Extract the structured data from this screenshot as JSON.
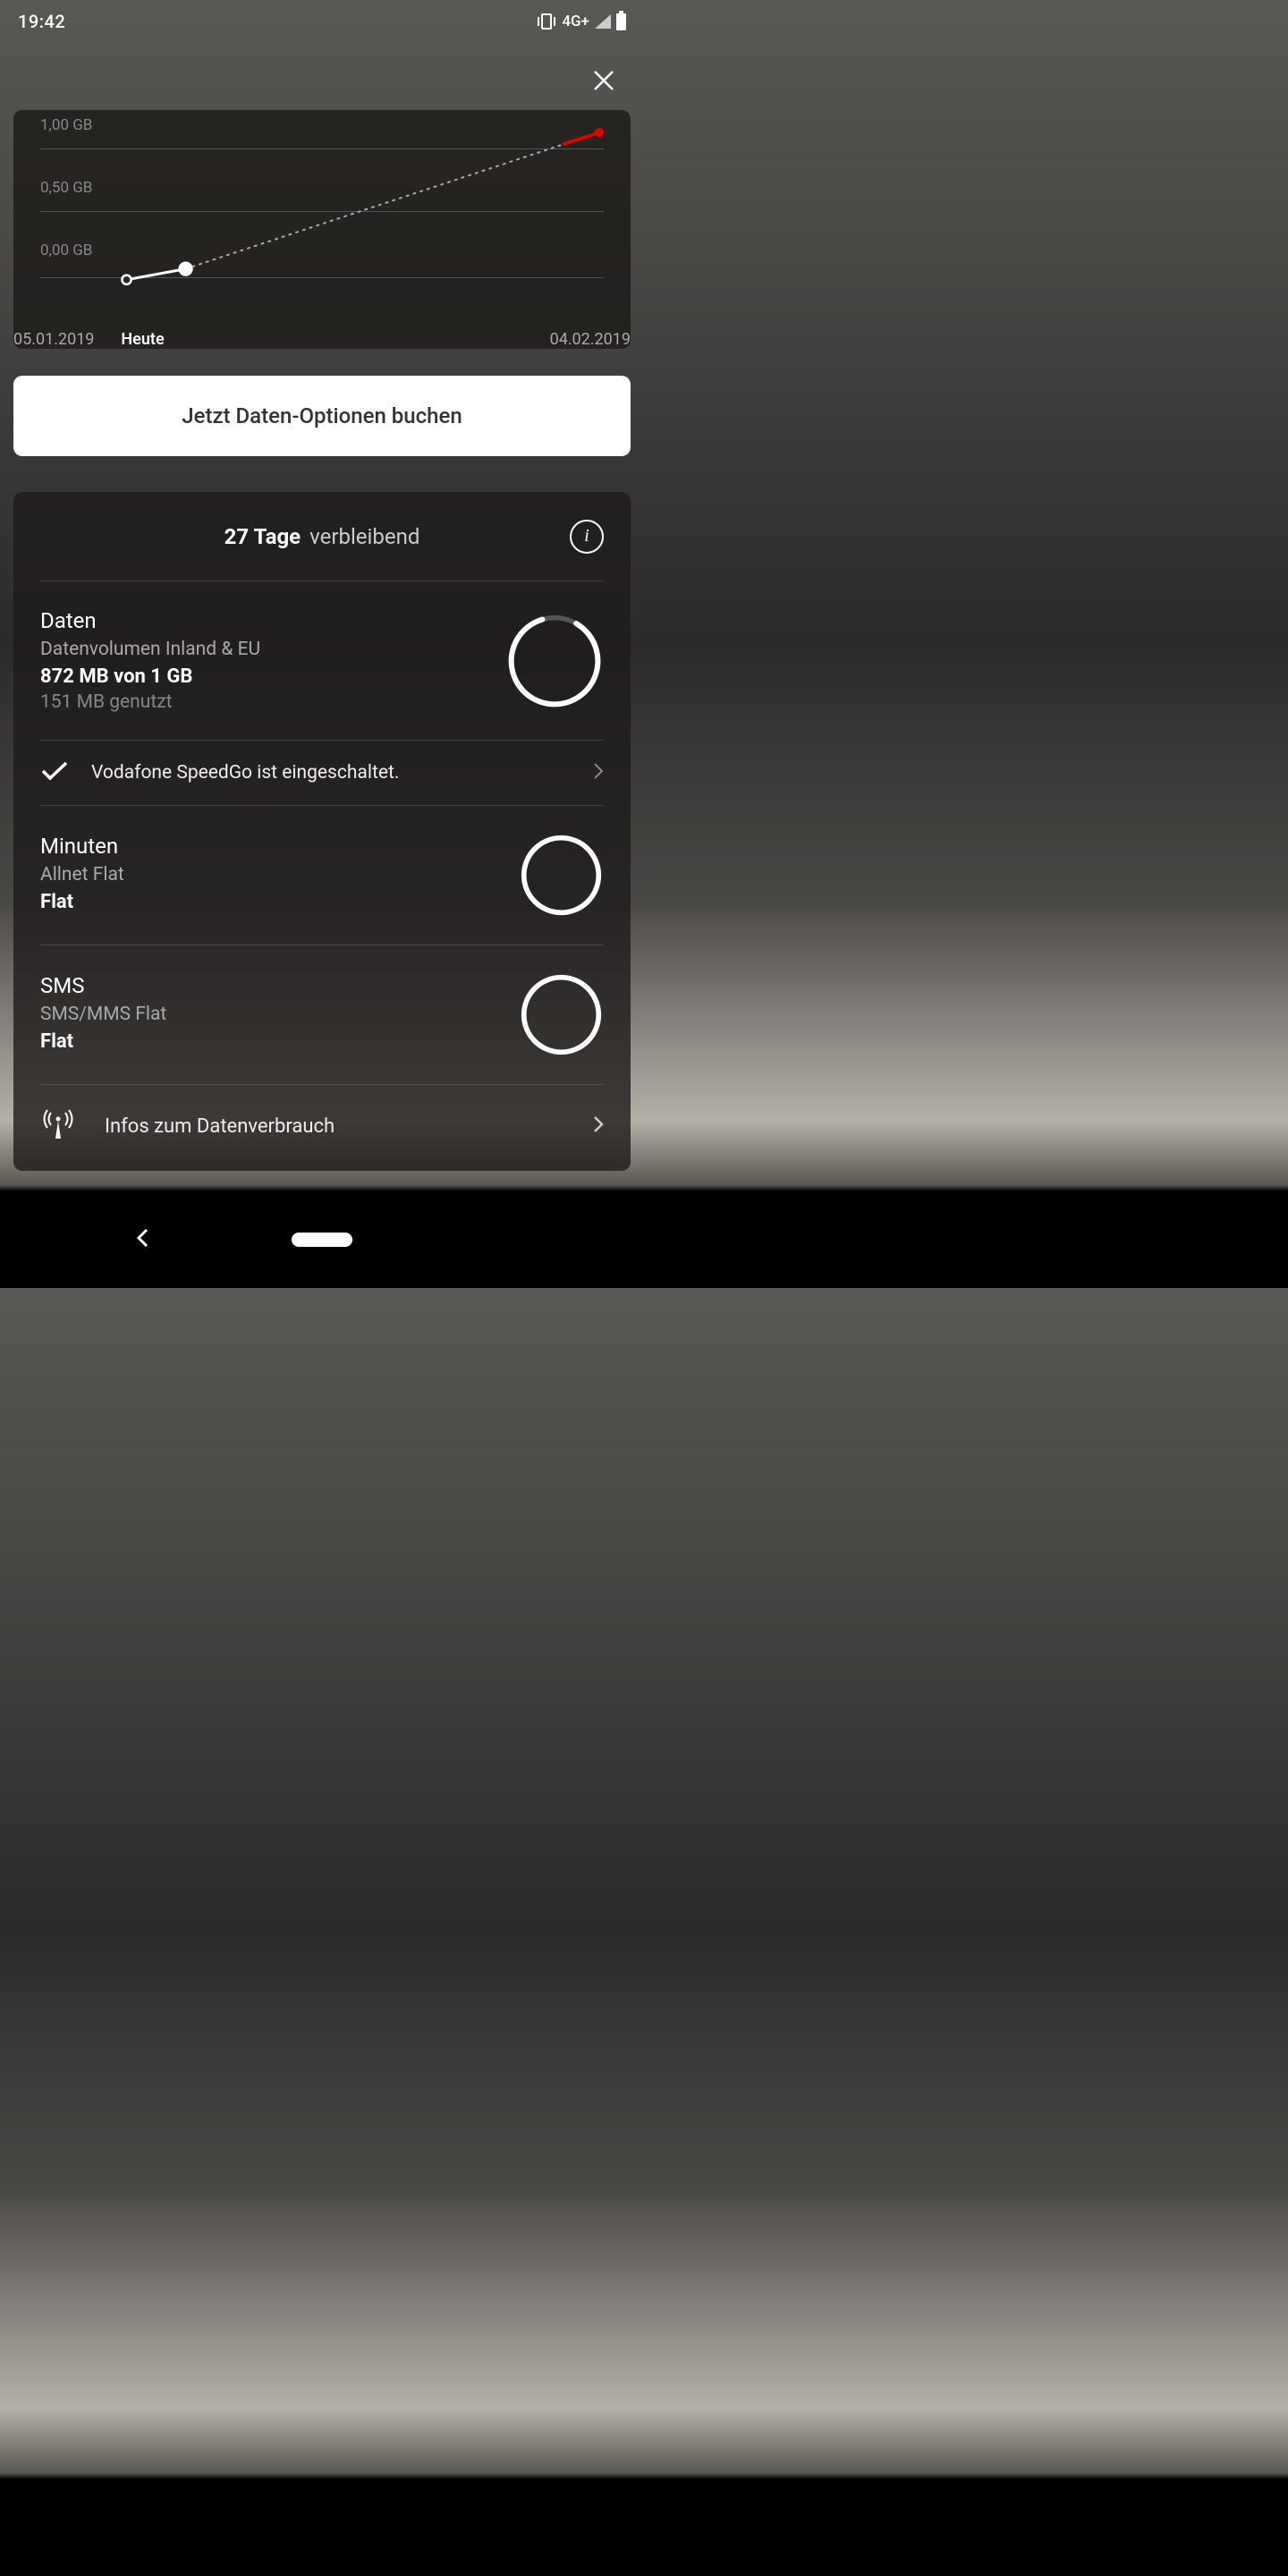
{
  "status": {
    "time": "19:42",
    "network": "4G+"
  },
  "chart_data": {
    "type": "line",
    "title": "",
    "ylabel": "",
    "xlabel": "",
    "y_ticks": [
      "1,00 GB",
      "0,50 GB",
      "0,00 GB"
    ],
    "x_ticks": {
      "start": "05.01.2019",
      "today": "Heute",
      "end": "04.02.2019"
    },
    "ylim": [
      0,
      1
    ],
    "series": [
      {
        "name": "actual",
        "points": [
          {
            "x": 0.15,
            "y": 0.0
          },
          {
            "x": 0.25,
            "y": 0.08
          }
        ]
      },
      {
        "name": "projection",
        "points": [
          {
            "x": 0.25,
            "y": 0.08
          },
          {
            "x": 0.99,
            "y": 0.99
          }
        ]
      }
    ]
  },
  "cta": {
    "label": "Jetzt Daten-Optionen buchen"
  },
  "usage": {
    "days_bold": "27 Tage",
    "days_rest": "verbleibend",
    "data": {
      "title": "Daten",
      "subtitle": "Datenvolumen Inland & EU",
      "amount": "872 MB von 1 GB",
      "used": "151 MB genutzt",
      "ring_percent": 87
    },
    "speedgo": "Vodafone SpeedGo ist eingeschaltet.",
    "minutes": {
      "title": "Minuten",
      "subtitle": "Allnet Flat",
      "amount": "Flat",
      "ring_percent": 100
    },
    "sms": {
      "title": "SMS",
      "subtitle": "SMS/MMS Flat",
      "amount": "Flat",
      "ring_percent": 100
    },
    "info_link": "Infos zum Datenverbrauch"
  }
}
